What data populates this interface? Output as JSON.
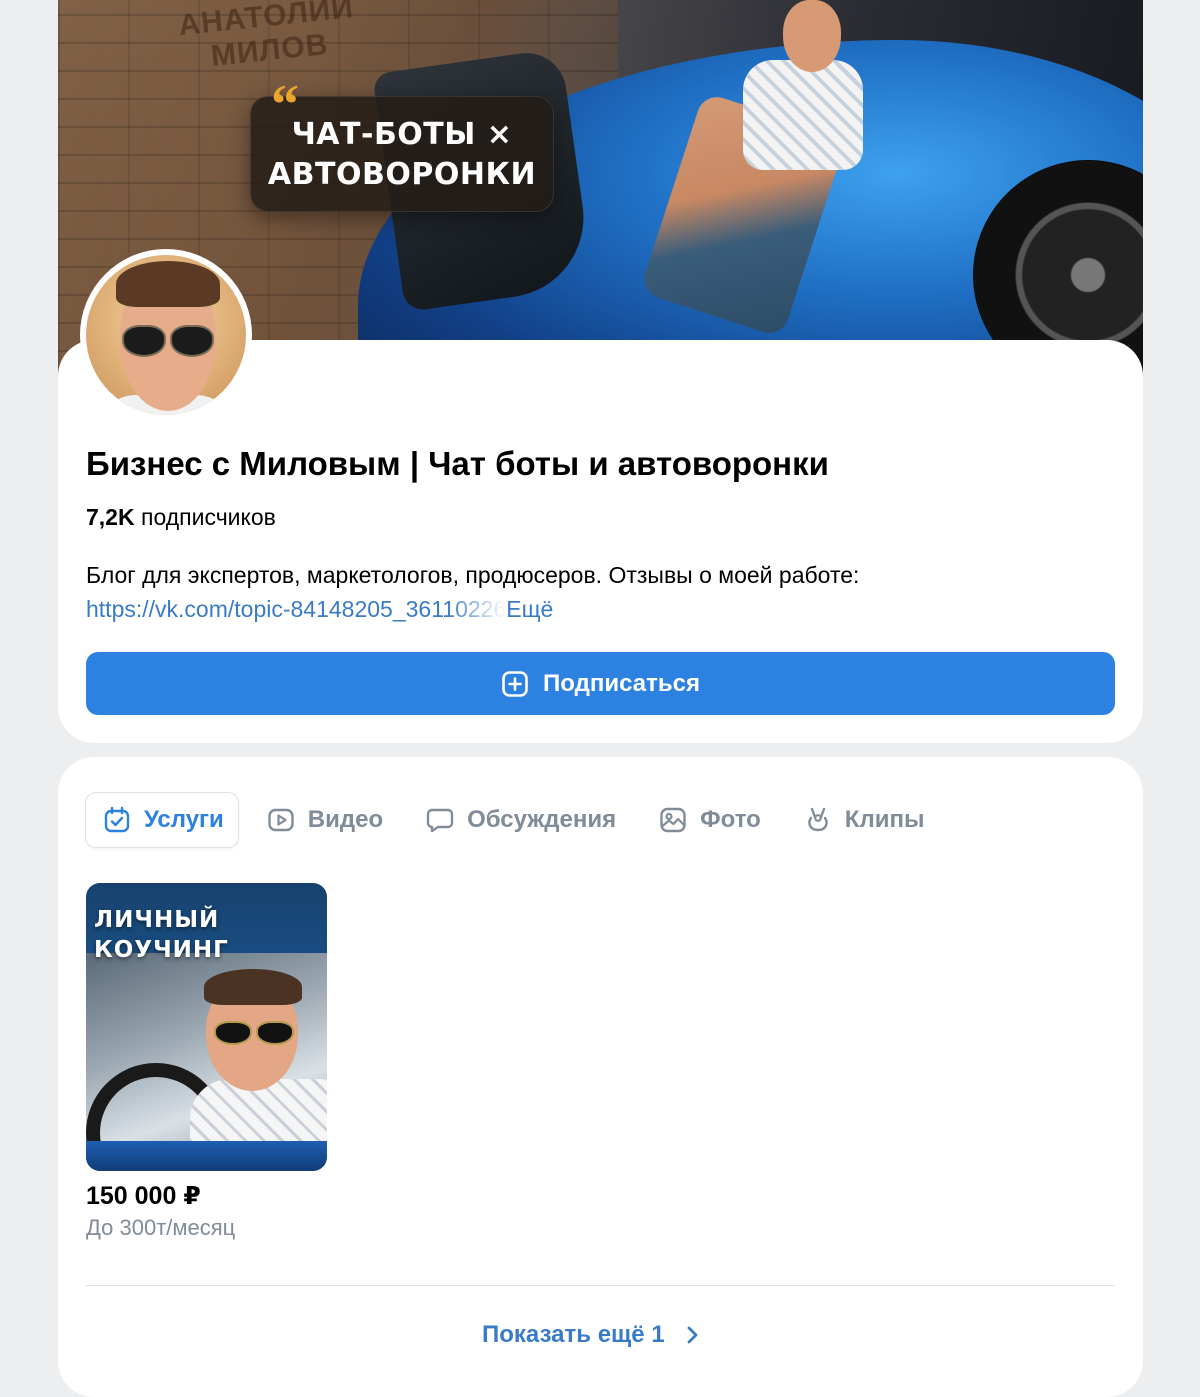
{
  "cover": {
    "wall_text": "АНАТОЛИЙ\nМИЛОВ",
    "bubble_text": "ЧАТ-БОТЫ ×\nАВТОВОРОНКИ",
    "bubble_quote": "“"
  },
  "group": {
    "title": "Бизнес с Миловым | Чат боты и автоворонки",
    "subscribers_count": "7,2K",
    "subscribers_label": "подписчиков",
    "description": "Блог для экспертов, маркетологов, продюсеров. Отзывы о моей работе:",
    "description_link": "https://vk.com/topic-84148205_36110226",
    "more_label": "Ещё",
    "subscribe_label": "Подписаться"
  },
  "tabs": [
    {
      "label": "Услуги",
      "icon": "calendar-check-icon",
      "active": true
    },
    {
      "label": "Видео",
      "icon": "video-play-icon",
      "active": false
    },
    {
      "label": "Обсуждения",
      "icon": "chat-bubble-icon",
      "active": false
    },
    {
      "label": "Фото",
      "icon": "photo-icon",
      "active": false
    },
    {
      "label": "Клипы",
      "icon": "clips-icon",
      "active": false
    }
  ],
  "products": [
    {
      "image_title": "ЛИЧНЫЙ\nКОУЧИНГ",
      "price": "150 000 ₽",
      "description": "До 300т/месяц"
    }
  ],
  "show_more_label": "Показать ещё 1",
  "colors": {
    "accent": "#2d81e0",
    "link": "#3a7bc8",
    "muted_text": "#818c99",
    "background": "#edeef0",
    "card": "#ffffff"
  }
}
